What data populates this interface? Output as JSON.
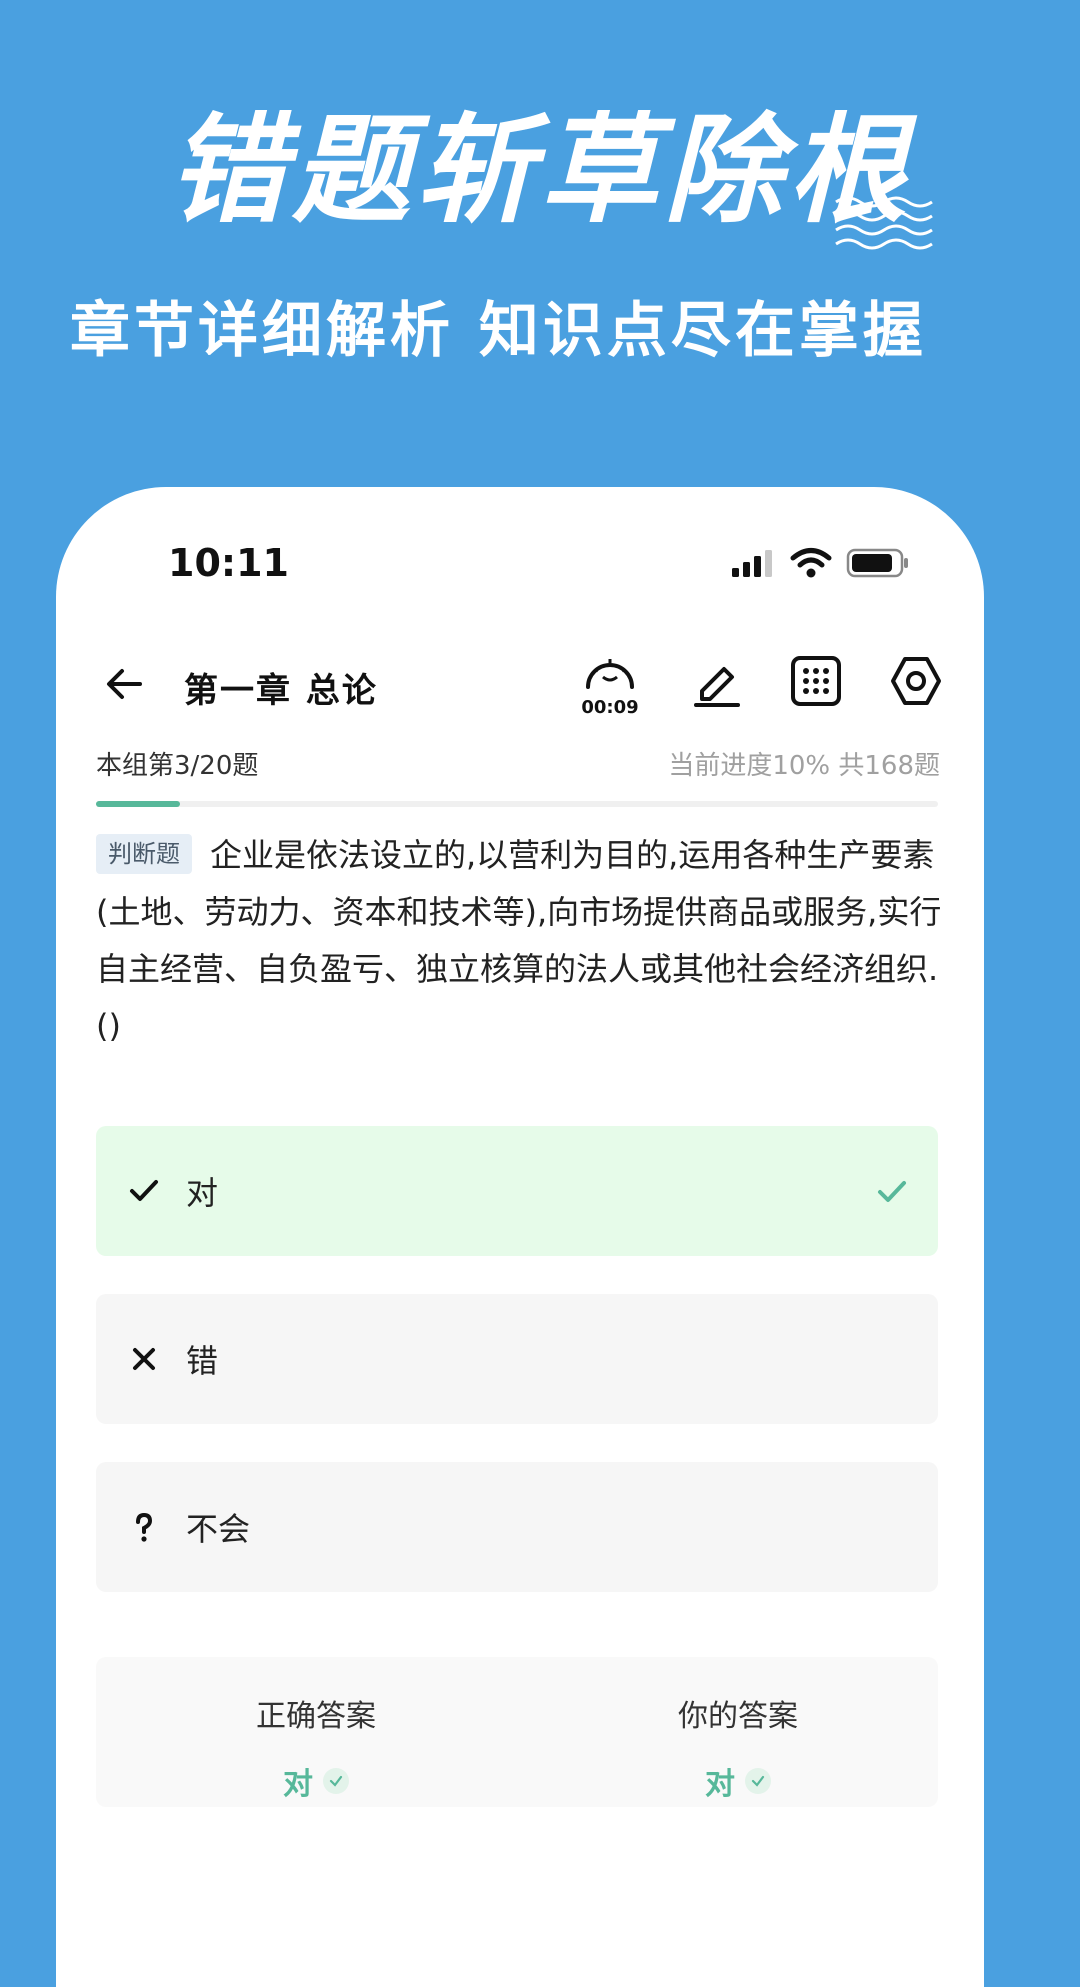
{
  "promo": {
    "headline": "错题斩草除根",
    "subline": "章节详细解析  知识点尽在掌握"
  },
  "status_bar": {
    "time": "10:11",
    "icons": [
      "signal-icon",
      "wifi-icon",
      "battery-icon"
    ]
  },
  "nav": {
    "title": "第一章 总论",
    "timer": "00:09",
    "icons": [
      "back-arrow-icon",
      "timer-icon",
      "pen-icon",
      "grid-icon",
      "settings-icon"
    ]
  },
  "progress": {
    "group_text": "本组第3/20题",
    "summary_text": "当前进度10%  共168题",
    "fraction": 0.1
  },
  "question": {
    "type_tag": "判断题",
    "text": "企业是依法设立的,以营利为目的,运用各种生产要素(土地、劳动力、资本和技术等),向市场提供商品或服务,实行自主经营、自负盈亏、独立核算的法人或其他社会经济组织.()"
  },
  "options": [
    {
      "label": "对",
      "icon": "check-icon",
      "state": "correct"
    },
    {
      "label": "错",
      "icon": "cross-icon",
      "state": "none"
    },
    {
      "label": "不会",
      "icon": "question-icon",
      "state": "none"
    }
  ],
  "answers": {
    "correct_title": "正确答案",
    "correct_value": "对",
    "yours_title": "你的答案",
    "yours_value": "对"
  },
  "colors": {
    "background": "#4aa0e0",
    "accent_green": "#57b89a",
    "correct_bg": "#e6fbe9",
    "option_bg": "#f6f6f6"
  }
}
